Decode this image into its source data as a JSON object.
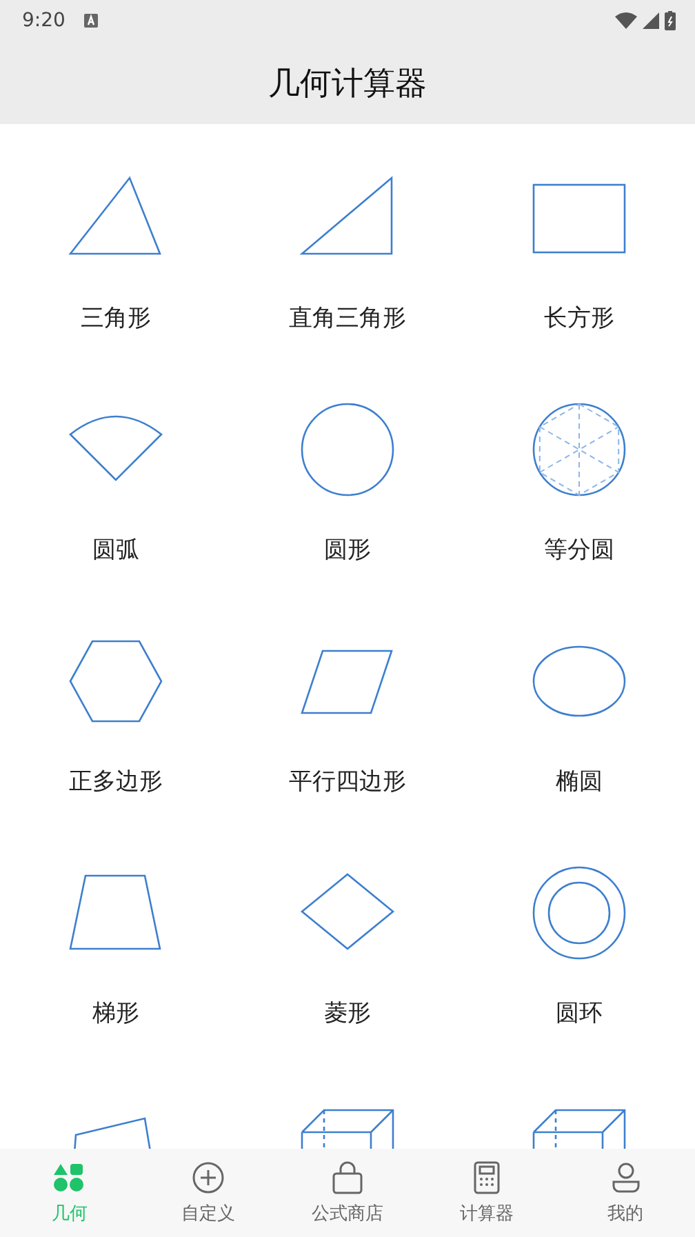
{
  "status_bar": {
    "time": "9:20"
  },
  "title": "几何计算器",
  "shapes": [
    {
      "kind": "triangle",
      "label": "三角形"
    },
    {
      "kind": "right-triangle",
      "label": "直角三角形"
    },
    {
      "kind": "rectangle",
      "label": "长方形"
    },
    {
      "kind": "sector",
      "label": "圆弧"
    },
    {
      "kind": "circle",
      "label": "圆形"
    },
    {
      "kind": "divided-circle",
      "label": "等分圆"
    },
    {
      "kind": "hexagon",
      "label": "正多边形"
    },
    {
      "kind": "parallelogram",
      "label": "平行四边形"
    },
    {
      "kind": "ellipse",
      "label": "椭圆"
    },
    {
      "kind": "trapezoid",
      "label": "梯形"
    },
    {
      "kind": "rhombus",
      "label": "菱形"
    },
    {
      "kind": "ring",
      "label": "圆环"
    },
    {
      "kind": "quadrilateral"
    },
    {
      "kind": "cuboid"
    },
    {
      "kind": "cuboid"
    }
  ],
  "tabs": [
    {
      "kind": "shapes",
      "label": "几何",
      "selected": true
    },
    {
      "kind": "add",
      "label": "自定义",
      "selected": false
    },
    {
      "kind": "bag",
      "label": "公式商店",
      "selected": false
    },
    {
      "kind": "calculator",
      "label": "计算器",
      "selected": false
    },
    {
      "kind": "person",
      "label": "我的",
      "selected": false
    }
  ]
}
